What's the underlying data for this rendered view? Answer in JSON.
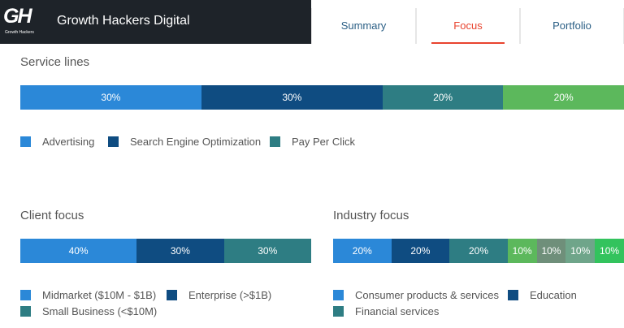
{
  "colors": {
    "blue": "#2b88d8",
    "navy": "#0f4c81",
    "teal": "#2e7d83",
    "green": "#5cb85c",
    "gray_green": "#6b9c78",
    "gray": "#7fa38b",
    "bright_green": "#33c35d"
  },
  "header": {
    "logo_letters": "GH",
    "logo_subtext": "Growth Hackers",
    "brand": "Growth Hackers Digital"
  },
  "tabs": [
    {
      "label": "Summary",
      "active": false
    },
    {
      "label": "Focus",
      "active": true
    },
    {
      "label": "Portfolio",
      "active": false
    }
  ],
  "service_lines": {
    "title": "Service lines",
    "segments": [
      {
        "label": "30%",
        "value": 30,
        "color": "#2b88d8"
      },
      {
        "label": "30%",
        "value": 30,
        "color": "#0f4c81"
      },
      {
        "label": "20%",
        "value": 20,
        "color": "#2e7d83"
      },
      {
        "label": "20%",
        "value": 20,
        "color": "#5cb85c"
      }
    ],
    "legend": [
      {
        "label": "Advertising",
        "color": "#2b88d8"
      },
      {
        "label": "Search Engine Optimization",
        "color": "#0f4c81"
      },
      {
        "label": "Pay Per Click",
        "color": "#2e7d83"
      }
    ]
  },
  "client_focus": {
    "title": "Client focus",
    "segments": [
      {
        "label": "40%",
        "value": 40,
        "color": "#2b88d8"
      },
      {
        "label": "30%",
        "value": 30,
        "color": "#0f4c81"
      },
      {
        "label": "30%",
        "value": 30,
        "color": "#2e7d83"
      }
    ],
    "legend": [
      {
        "label": "Midmarket ($10M - $1B)",
        "color": "#2b88d8"
      },
      {
        "label": "Enterprise (>$1B)",
        "color": "#0f4c81"
      },
      {
        "label": "Small Business (<$10M)",
        "color": "#2e7d83"
      }
    ]
  },
  "industry_focus": {
    "title": "Industry focus",
    "segments": [
      {
        "label": "20%",
        "value": 20,
        "color": "#2b88d8"
      },
      {
        "label": "20%",
        "value": 20,
        "color": "#0f4c81"
      },
      {
        "label": "20%",
        "value": 20,
        "color": "#2e7d83"
      },
      {
        "label": "10%",
        "value": 10,
        "color": "#5cb85c"
      },
      {
        "label": "10%",
        "value": 10,
        "color": "#6f8f7a"
      },
      {
        "label": "10%",
        "value": 10,
        "color": "#6fa58a"
      },
      {
        "label": "10%",
        "value": 10,
        "color": "#33c35d"
      }
    ],
    "legend": [
      {
        "label": "Consumer products & services",
        "color": "#2b88d8"
      },
      {
        "label": "Education",
        "color": "#0f4c81"
      },
      {
        "label": "Financial services",
        "color": "#2e7d83"
      }
    ]
  }
}
